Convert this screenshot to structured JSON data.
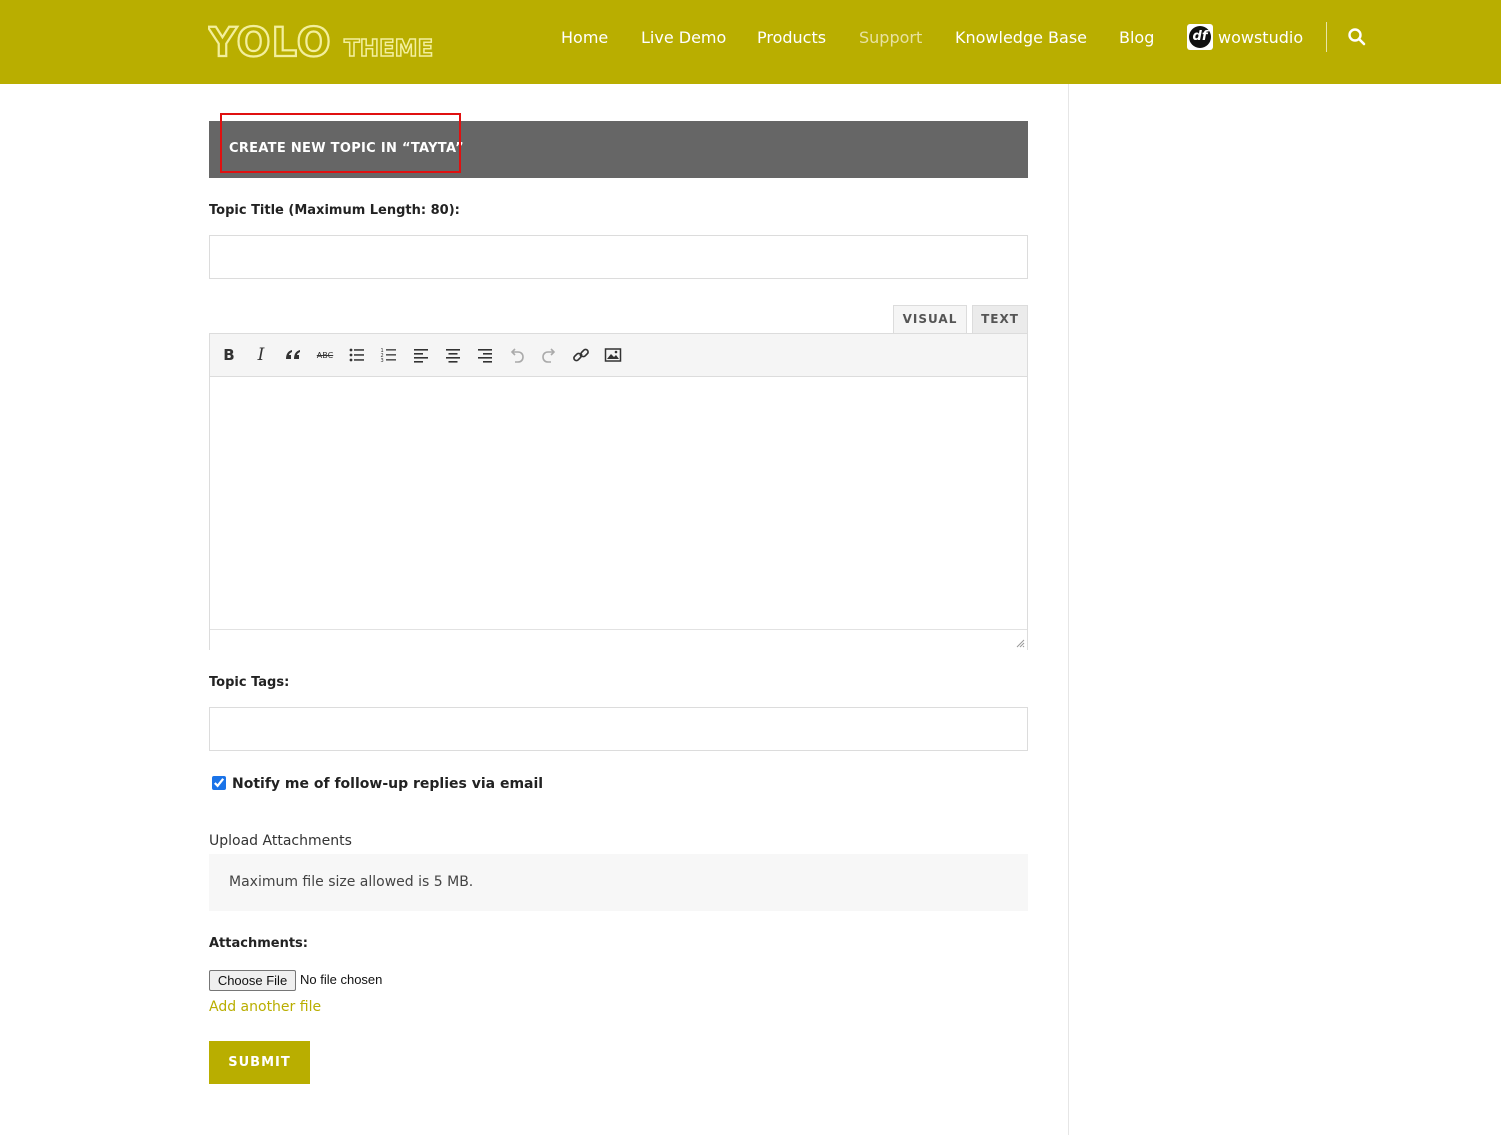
{
  "brand": {
    "logo_text_main": "YOLO",
    "logo_text_sub": "THEME",
    "color": "#b9ae00"
  },
  "nav": {
    "items": [
      "Home",
      "Live Demo",
      "Products",
      "Support",
      "Knowledge Base",
      "Blog"
    ],
    "active": "Support",
    "user_name": "wowstudio",
    "user_avatar_text": "df",
    "search_icon": "search-icon"
  },
  "form": {
    "heading": "CREATE NEW TOPIC IN “TAYTA”",
    "title_label": "Topic Title (Maximum Length: 80):",
    "title_value": "",
    "editor": {
      "tabs": [
        "VISUAL",
        "TEXT"
      ],
      "active_tab": "VISUAL",
      "toolbar": [
        "bold-icon",
        "italic-icon",
        "blockquote-icon",
        "strikethrough-icon",
        "bullet-list-icon",
        "numbered-list-icon",
        "align-left-icon",
        "align-center-icon",
        "align-right-icon",
        "undo-icon",
        "redo-icon",
        "link-icon",
        "image-icon"
      ],
      "bold_glyph": "B",
      "italic_glyph": "I",
      "strike_glyph": "ABC",
      "content": ""
    },
    "tags_label": "Topic Tags:",
    "tags_value": "",
    "notify_label": "Notify me of follow-up replies via email",
    "notify_checked": true,
    "upload": {
      "title": "Upload Attachments",
      "info": "Maximum file size allowed is 5 MB.",
      "attachments_label": "Attachments:",
      "choose_button": "Choose File",
      "no_file": "No file chosen",
      "add_another": "Add another file"
    },
    "submit_label": "SUBMIT"
  }
}
